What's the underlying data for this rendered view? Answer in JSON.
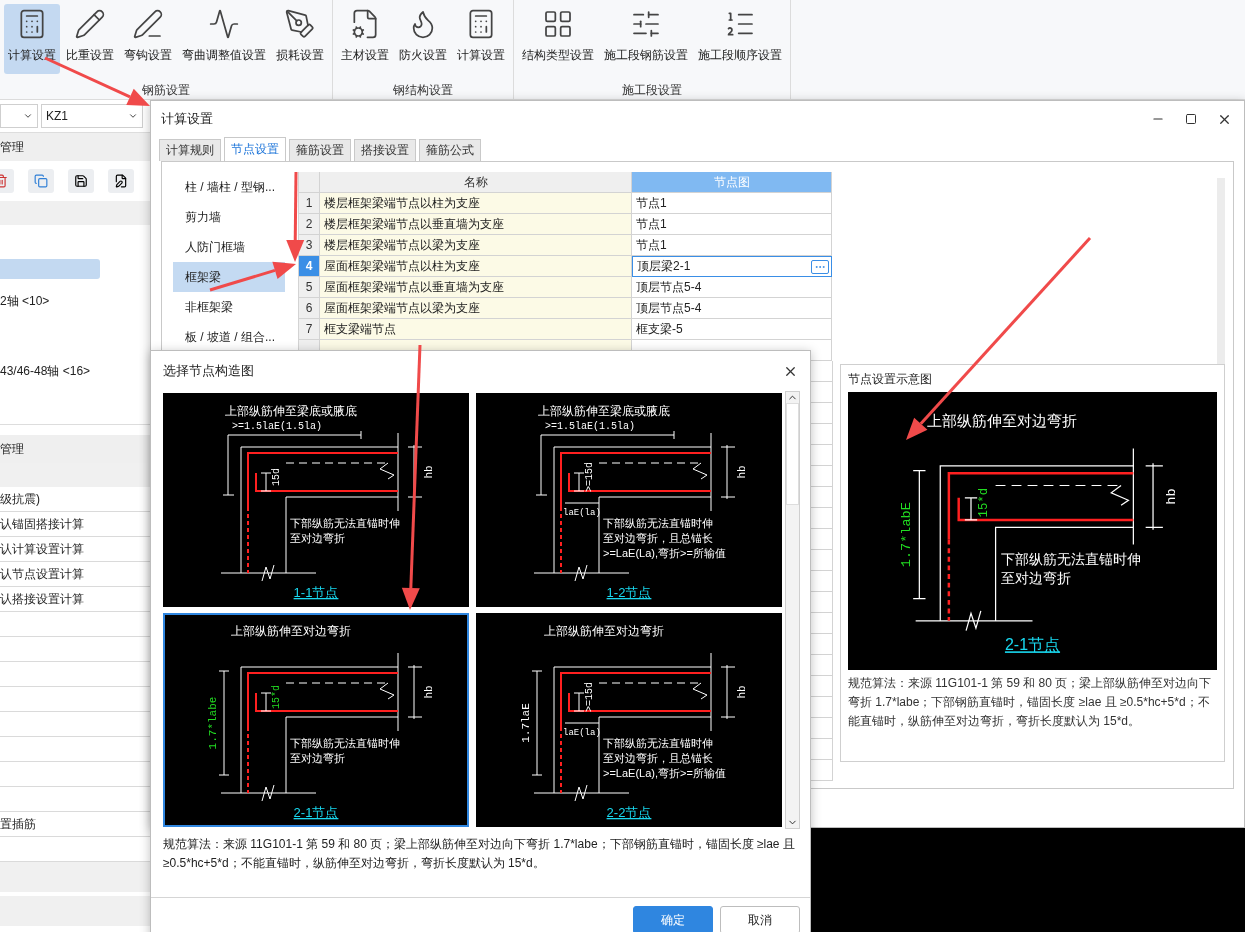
{
  "ribbon": {
    "groups": [
      {
        "label": "钢筋设置",
        "buttons": [
          {
            "label": "计算设置",
            "selected": true
          },
          {
            "label": "比重设置",
            "selected": false
          },
          {
            "label": "弯钩设置",
            "selected": false
          },
          {
            "label": "弯曲调整值设置",
            "selected": false
          },
          {
            "label": "损耗设置",
            "selected": false
          }
        ]
      },
      {
        "label": "钢结构设置",
        "buttons": [
          {
            "label": "主材设置",
            "selected": false
          },
          {
            "label": "防火设置",
            "selected": false
          },
          {
            "label": "计算设置",
            "selected": false
          }
        ]
      },
      {
        "label": "施工段设置",
        "buttons": [
          {
            "label": "结构类型设置",
            "selected": false
          },
          {
            "label": "施工段钢筋设置",
            "selected": false
          },
          {
            "label": "施工段顺序设置",
            "selected": false
          }
        ]
      }
    ]
  },
  "left_panel": {
    "component_dropdown": {
      "value": "KZ1"
    },
    "section_1_title": "管理",
    "tree_items": [
      "2轴 <10>",
      "43/46-48轴 <16>"
    ],
    "section_2_title": "管理",
    "property_rows": [
      "级抗震)",
      "认锚固搭接计算",
      "认计算设置计算",
      "认节点设置计算",
      "认搭接设置计算"
    ],
    "property_rows_lower": [
      "置插筋"
    ]
  },
  "settings_dialog": {
    "title": "计算设置",
    "tabs": [
      {
        "label": "计算规则",
        "selected": false
      },
      {
        "label": "节点设置",
        "selected": true
      },
      {
        "label": "箍筋设置",
        "selected": false
      },
      {
        "label": "搭接设置",
        "selected": false
      },
      {
        "label": "箍筋公式",
        "selected": false
      }
    ],
    "categories": [
      {
        "label": "柱 / 墙柱 / 型钢...",
        "selected": false
      },
      {
        "label": "剪力墙",
        "selected": false
      },
      {
        "label": "人防门框墙",
        "selected": false
      },
      {
        "label": "框架梁",
        "selected": true
      },
      {
        "label": "非框架梁",
        "selected": false
      },
      {
        "label": "板 / 坡道 / 组合...",
        "selected": false
      }
    ],
    "table": {
      "columns": [
        "名称",
        "节点图"
      ],
      "rows": [
        {
          "index": "1",
          "name": "楼层框架梁端节点以柱为支座",
          "value": "节点1",
          "selected": false
        },
        {
          "index": "2",
          "name": "楼层框架梁端节点以垂直墙为支座",
          "value": "节点1",
          "selected": false
        },
        {
          "index": "3",
          "name": "楼层框架梁端节点以梁为支座",
          "value": "节点1",
          "selected": false
        },
        {
          "index": "4",
          "name": "屋面框架梁端节点以柱为支座",
          "value": "顶层梁2-1",
          "selected": true
        },
        {
          "index": "5",
          "name": "屋面框架梁端节点以垂直墙为支座",
          "value": "顶层节点5-4",
          "selected": false
        },
        {
          "index": "6",
          "name": "屋面框架梁端节点以梁为支座",
          "value": "顶层节点5-4",
          "selected": false
        },
        {
          "index": "7",
          "name": "框支梁端节点",
          "value": "框支梁-5",
          "selected": false
        }
      ]
    },
    "preview": {
      "title": "节点设置示意图",
      "diagram": {
        "kind": "side-anchor",
        "title": "上部纵筋伸至对边弯折",
        "vertical": "1.7*labE",
        "hook": "15*d",
        "height_label": "hb",
        "notes": [
          "下部纵筋无法直锚时伸",
          "至对边弯折"
        ],
        "caption": "2-1节点",
        "highlight": true
      },
      "description": "规范算法：来源 11G101-1 第 59 和 80 页；梁上部纵筋伸至对边向下弯折 1.7*labe；下部钢筋直锚时，锚固长度 ≥lae 且 ≥0.5*hc+5*d；不能直锚时，纵筋伸至对边弯折，弯折长度默认为 15*d。"
    }
  },
  "picker_dialog": {
    "title": "选择节点构造图",
    "options": [
      {
        "kind": "top-anchor",
        "title": "上部纵筋伸至梁底或腋底",
        "dimension": ">=1.5laE(1.5la)",
        "hook": "15d",
        "height_label": "hb",
        "notes": [
          "下部纵筋无法直锚时伸",
          "至对边弯折"
        ],
        "caption": "1-1节点",
        "highlight": false,
        "selected": false
      },
      {
        "kind": "top-anchor",
        "title": "上部纵筋伸至梁底或腋底",
        "dimension": ">=1.5laE(1.5la)",
        "hook": ">=15d",
        "anchor": "laE(la)",
        "height_label": "hb",
        "notes": [
          "下部纵筋无法直锚时伸",
          "至对边弯折，且总锚长",
          ">=LaE(La),弯折>=所输值"
        ],
        "caption": "1-2节点",
        "highlight": false,
        "selected": false
      },
      {
        "kind": "side-anchor",
        "title": "上部纵筋伸至对边弯折",
        "vertical": "1.7*labe",
        "hook": "15*d",
        "height_label": "hb",
        "notes": [
          "下部纵筋无法直锚时伸",
          "至对边弯折"
        ],
        "caption": "2-1节点",
        "highlight": true,
        "selected": true
      },
      {
        "kind": "side-anchor",
        "title": "上部纵筋伸至对边弯折",
        "vertical": "1.7laE",
        "hook": ">=15d",
        "anchor": "laE(la)",
        "height_label": "hb",
        "notes": [
          "下部纵筋无法直锚时伸",
          "至对边弯折，且总锚长",
          ">=LaE(La),弯折>=所输值"
        ],
        "caption": "2-2节点",
        "highlight": false,
        "selected": false
      }
    ],
    "description": "规范算法：来源 11G101-1 第 59 和 80 页；梁上部纵筋伸至对边向下弯折 1.7*labe；下部钢筋直锚时，锚固长度 ≥lae 且 ≥0.5*hc+5*d；不能直锚时，纵筋伸至对边弯折，弯折长度默认为 15*d。",
    "buttons": [
      {
        "label": "确定",
        "kind": "primary"
      },
      {
        "label": "取消",
        "kind": "secondary"
      }
    ]
  }
}
